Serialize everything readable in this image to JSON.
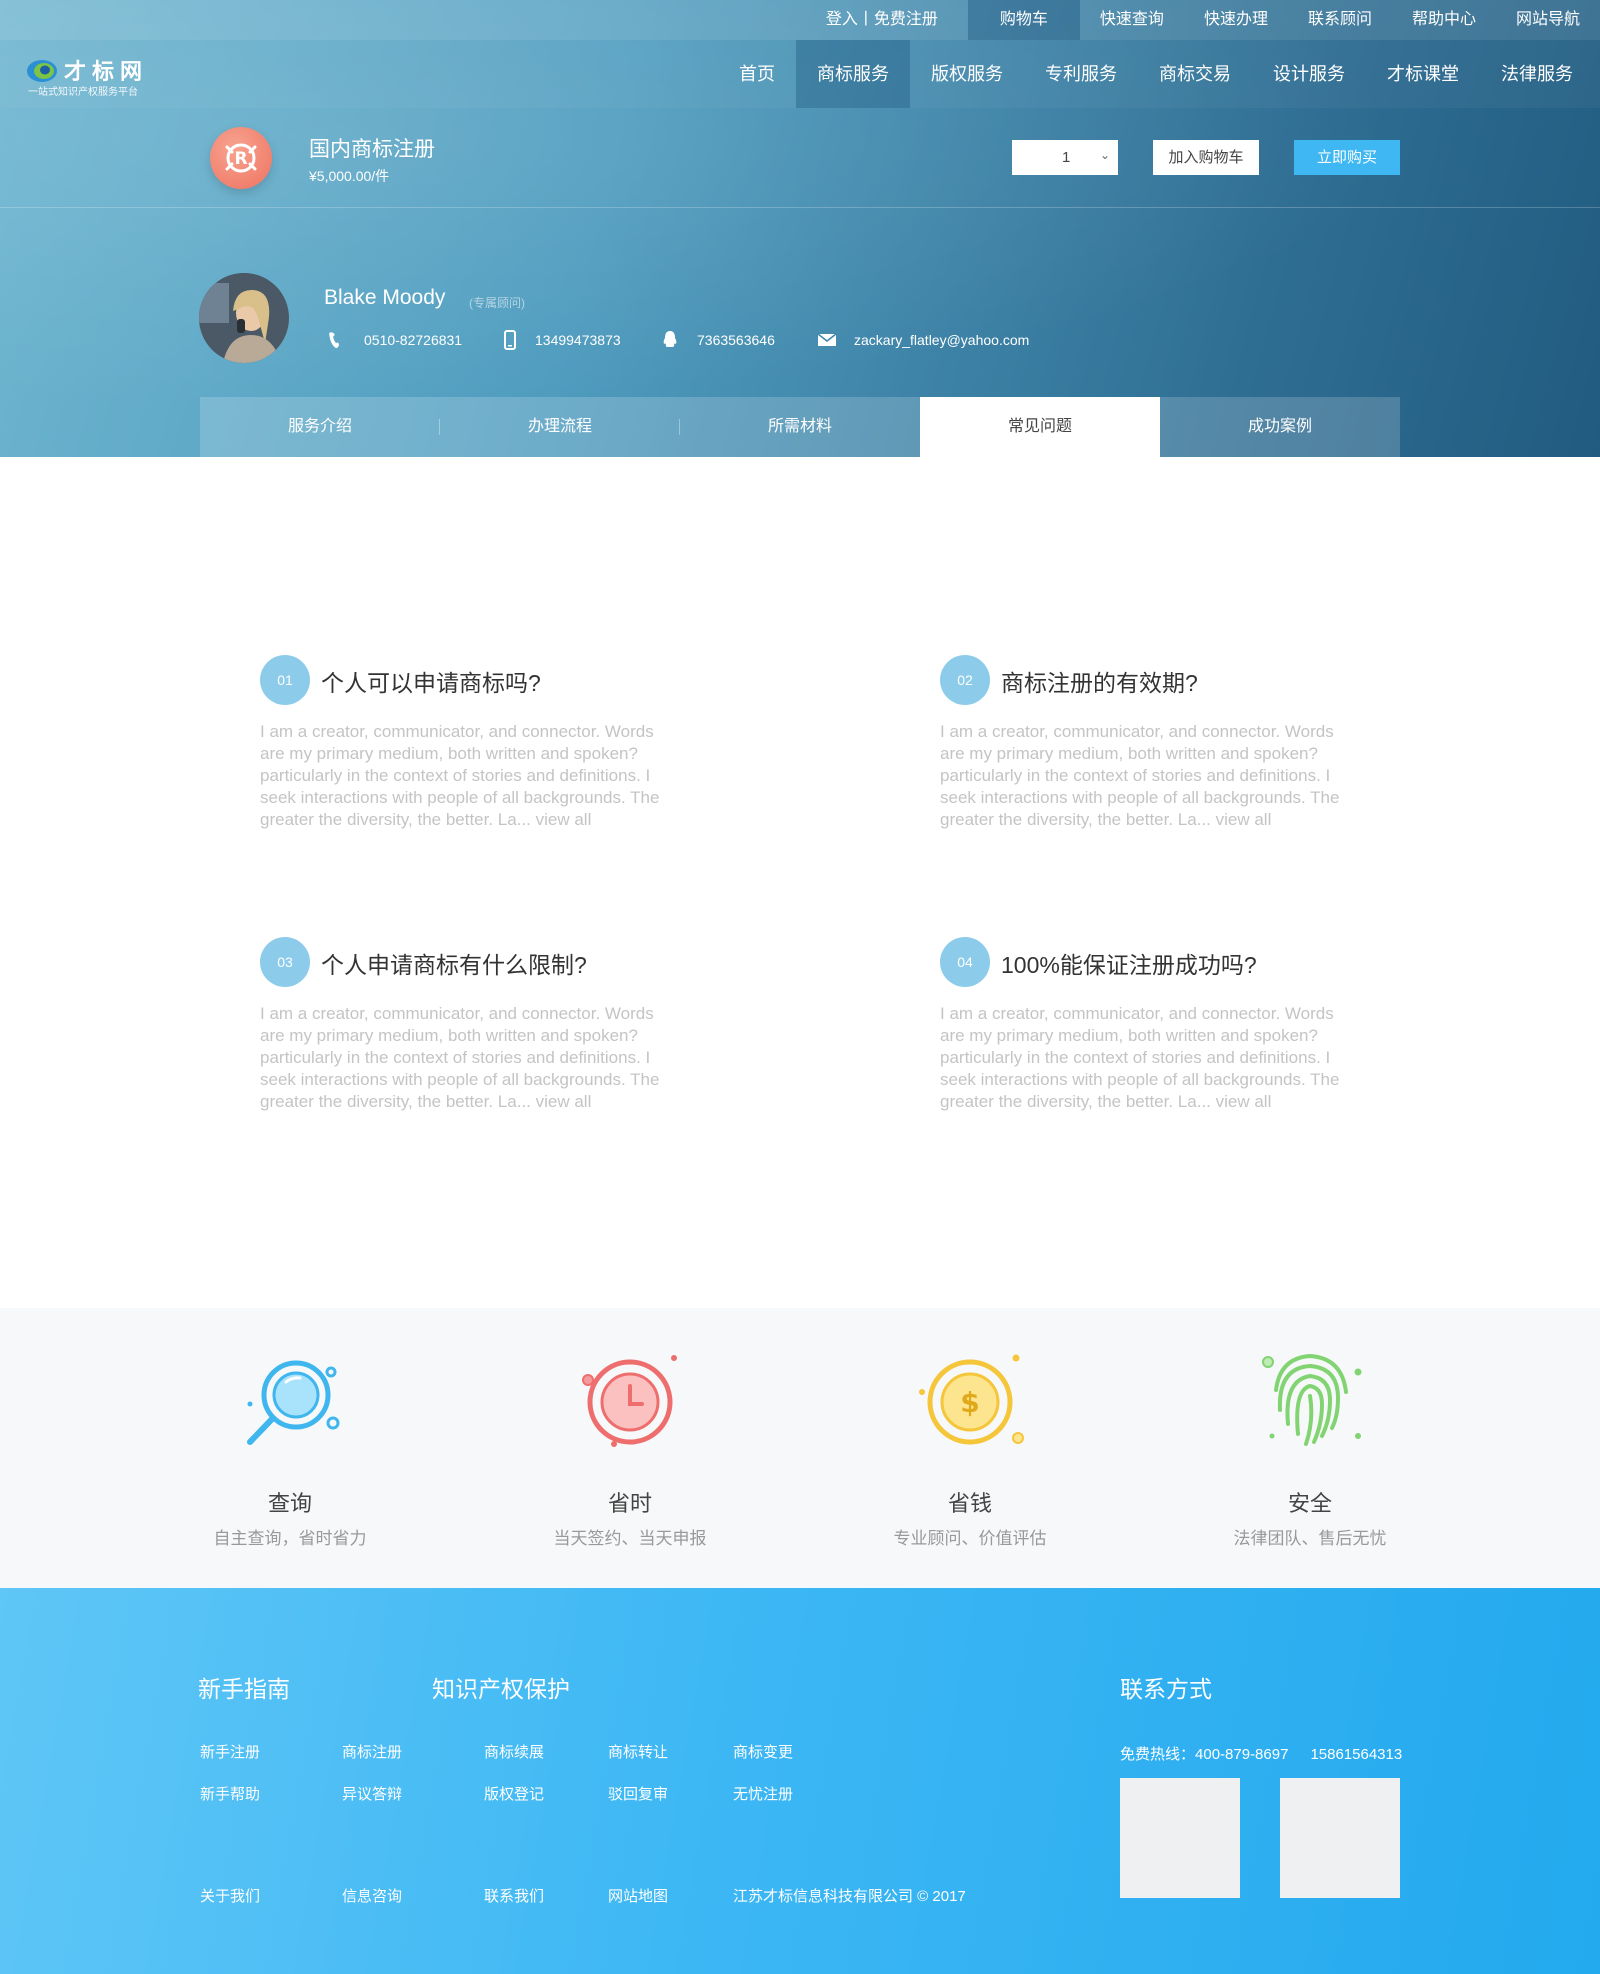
{
  "topbar": {
    "login": "登入丨免费注册",
    "cart": "购物车",
    "links": [
      "快速查询",
      "快速办理",
      "联系顾问",
      "帮助中心",
      "网站导航"
    ]
  },
  "logo": {
    "name": "才标网",
    "tagline": "一站式知识产权服务平台"
  },
  "nav": {
    "items": [
      "首页",
      "商标服务",
      "版权服务",
      "专利服务",
      "商标交易",
      "设计服务",
      "才标课堂",
      "法律服务"
    ],
    "active": "商标服务"
  },
  "product": {
    "title": "国内商标注册",
    "price": "¥5,000.00/件",
    "quantity": "1",
    "add_to_cart": "加入购物车",
    "buy_now": "立即购买"
  },
  "consultant": {
    "name": "Blake Moody",
    "role": "(专属顾问)",
    "phone": "0510-82726831",
    "mobile": "13499473873",
    "qq": "7363563646",
    "email": "zackary_flatley@yahoo.com"
  },
  "tabs": {
    "items": [
      "服务介绍",
      "办理流程",
      "所需材料",
      "常见问题",
      "成功案例"
    ],
    "active": "常见问题"
  },
  "faq": [
    {
      "num": "01",
      "question": "个人可以申请商标吗?",
      "answer": "I am a creator, communicator, and connector. Words are my primary medium, both written and spoken?particularly in the context of stories and definitions. I seek interactions with people of all backgrounds. The greater the diversity, the better. La... view all"
    },
    {
      "num": "02",
      "question": "商标注册的有效期?",
      "answer": "I am a creator, communicator, and connector. Words are my primary medium, both written and spoken?particularly in the context of stories and definitions. I seek interactions with people of all backgrounds. The greater the diversity, the better. La... view all"
    },
    {
      "num": "03",
      "question": "个人申请商标有什么限制?",
      "answer": "I am a creator, communicator, and connector. Words are my primary medium, both written and spoken?particularly in the context of stories and definitions. I seek interactions with people of all backgrounds. The greater the diversity, the better. La... view all"
    },
    {
      "num": "04",
      "question": "100%能保证注册成功吗?",
      "answer": "I am a creator, communicator, and connector. Words are my primary medium, both written and spoken?particularly in the context of stories and definitions. I seek interactions with people of all backgrounds. The greater the diversity, the better. La... view all"
    }
  ],
  "features": [
    {
      "title": "查询",
      "desc": "自主查询，省时省力",
      "icon": "search-icon",
      "color": "#3fb7ee"
    },
    {
      "title": "省时",
      "desc": "当天签约、当天申报",
      "icon": "clock-icon",
      "color": "#ee6e6e"
    },
    {
      "title": "省钱",
      "desc": "专业顾问、价值评估",
      "icon": "coin-icon",
      "color": "#f5c53a"
    },
    {
      "title": "安全",
      "desc": "法律团队、售后无忧",
      "icon": "fingerprint-icon",
      "color": "#82d472"
    }
  ],
  "footer": {
    "guide_title": "新手指南",
    "ip_title": "知识产权保护",
    "contact_title": "联系方式",
    "row1": [
      "新手注册",
      "商标注册",
      "商标续展",
      "商标转让",
      "商标变更"
    ],
    "row2": [
      "新手帮助",
      "异议答辩",
      "版权登记",
      "驳回复审",
      "无忧注册"
    ],
    "row3": [
      "关于我们",
      "信息咨询",
      "联系我们",
      "网站地图",
      "江苏才标信息科技有限公司 © 2017"
    ],
    "hotline_label": "免费热线：",
    "hotline": "400-879-8697",
    "hotline2": "15861564313"
  },
  "colors": {
    "accent": "#3eb7f2",
    "number_badge": "#8ccbea",
    "product_icon": "#ee7260"
  }
}
